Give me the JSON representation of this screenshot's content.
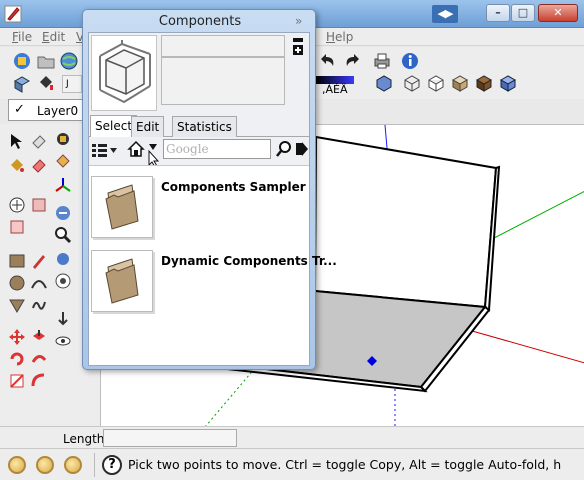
{
  "window": {
    "nav_arrows": "◀▶",
    "controls": [
      "minimize",
      "maximize",
      "close"
    ]
  },
  "menu": {
    "items": [
      {
        "underline": "F",
        "rest": "ile"
      },
      {
        "underline": "E",
        "rest": "dit"
      },
      {
        "underline": "V",
        "rest": ""
      },
      {
        "underline": "H",
        "rest": "elp"
      }
    ]
  },
  "toolbar": {
    "layer_name": "Layer0",
    "layer_check": "✓",
    "style_label": ",ÀÉÄ"
  },
  "dialog": {
    "title": "Components",
    "close_glyph": "»",
    "tabs": [
      "Select",
      "Edit",
      "Statistics"
    ],
    "active_tab": "Select",
    "search_placeholder": "Google",
    "items": [
      {
        "label": "Components Sampler",
        "icon": "folder-icon"
      },
      {
        "label": "Dynamic Components Tr...",
        "icon": "folder-icon"
      }
    ]
  },
  "measurements": {
    "label": "Length",
    "value": ""
  },
  "status": {
    "help_glyph": "?",
    "message": "Pick two points to move.  Ctrl = toggle Copy, Alt = toggle Auto-fold, h"
  },
  "colors": {
    "title_bar": "#7aa8dd",
    "axis_blue": "#0000d0",
    "axis_red": "#c00000",
    "axis_green": "#00a000",
    "floor": "#c8c8c8"
  }
}
